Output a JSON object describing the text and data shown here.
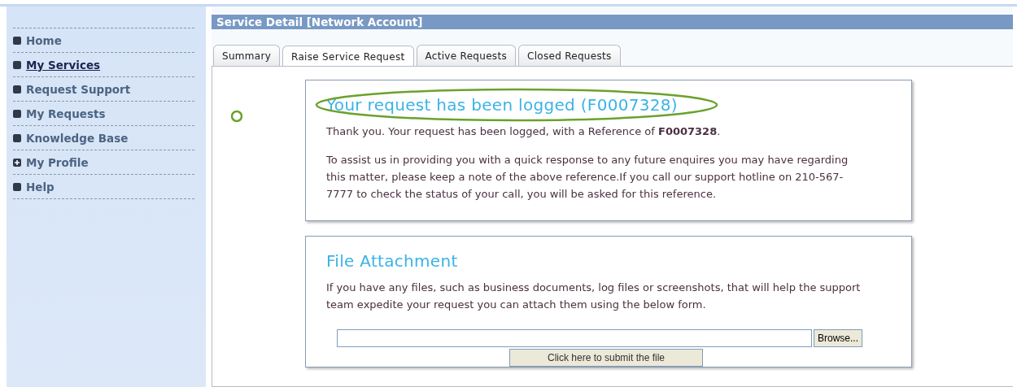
{
  "sidebar": {
    "items": [
      {
        "label": "Home",
        "kind": "bullet",
        "selected": false
      },
      {
        "label": "My Services",
        "kind": "bullet",
        "selected": true
      },
      {
        "label": "Request Support",
        "kind": "bullet",
        "selected": false
      },
      {
        "label": "My Requests",
        "kind": "bullet",
        "selected": false
      },
      {
        "label": "Knowledge Base",
        "kind": "bullet",
        "selected": false
      },
      {
        "label": "My Profile",
        "kind": "expand",
        "selected": false
      },
      {
        "label": "Help",
        "kind": "bullet",
        "selected": false
      }
    ]
  },
  "title": "Service Detail [Network Account]",
  "tabs": [
    {
      "label": "Summary",
      "selected": false
    },
    {
      "label": "Raise Service Request",
      "selected": true
    },
    {
      "label": "Active Requests",
      "selected": false
    },
    {
      "label": "Closed Requests",
      "selected": false
    }
  ],
  "confirmation": {
    "heading": "Your request has been logged (F0007328)",
    "paragraphs": [
      "Thank you. Your request has been logged, with a Reference of **F0007328**.",
      "To assist us in providing you with a quick response to any future enquires you may have regarding this matter, please keep a note of the above reference.If you call our support hotline on 210-567-7777 to check the status of your call, you will be asked for this reference."
    ]
  },
  "attachment": {
    "heading": "File Attachment",
    "text": "If you have any files, such as business documents, log files or screenshots, that will help the support team expedite your request you can attach them using the below form.",
    "browse_button": "Browse...",
    "submit_button": "Click here to submit the file"
  }
}
